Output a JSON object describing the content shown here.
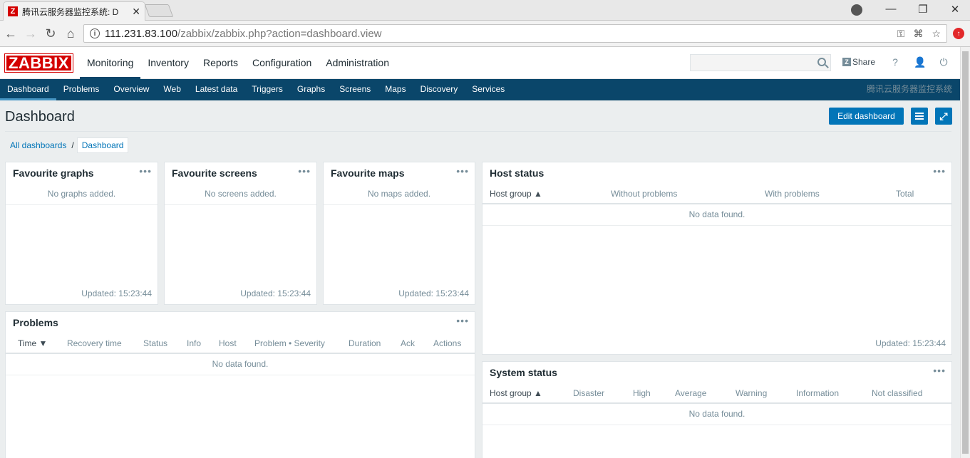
{
  "browser": {
    "tab_title": "腾讯云服务器监控系统: D",
    "tab_close": "✕",
    "url_host": "111.231.83.100",
    "url_path": "/zabbix/zabbix.php?action=dashboard.view",
    "minimize": "—",
    "restore": "❐",
    "close": "✕"
  },
  "header": {
    "logo": "ZABBIX",
    "menu": [
      "Monitoring",
      "Inventory",
      "Reports",
      "Configuration",
      "Administration"
    ],
    "share": "Share",
    "help": "?",
    "user": "👤",
    "logout": "⏻"
  },
  "submenu": {
    "items": [
      "Dashboard",
      "Problems",
      "Overview",
      "Web",
      "Latest data",
      "Triggers",
      "Graphs",
      "Screens",
      "Maps",
      "Discovery",
      "Services"
    ],
    "server_name": "腾讯云服务器监控系统"
  },
  "page": {
    "title": "Dashboard",
    "edit_button": "Edit dashboard",
    "breadcrumbs": {
      "all": "All dashboards",
      "sep": "/",
      "current": "Dashboard"
    }
  },
  "widgets": {
    "fav_graphs": {
      "title": "Favourite graphs",
      "empty": "No graphs added.",
      "updated": "Updated: 15:23:44"
    },
    "fav_screens": {
      "title": "Favourite screens",
      "empty": "No screens added.",
      "updated": "Updated: 15:23:44"
    },
    "fav_maps": {
      "title": "Favourite maps",
      "empty": "No maps added.",
      "updated": "Updated: 15:23:44"
    },
    "host_status": {
      "title": "Host status",
      "columns": [
        "Host group ▲",
        "Without problems",
        "With problems",
        "Total"
      ],
      "empty": "No data found.",
      "updated": "Updated: 15:23:44"
    },
    "problems": {
      "title": "Problems",
      "columns": [
        "Time ▼",
        "Recovery time",
        "Status",
        "Info",
        "Host",
        "Problem • Severity",
        "Duration",
        "Ack",
        "Actions"
      ],
      "empty": "No data found."
    },
    "system_status": {
      "title": "System status",
      "columns": [
        "Host group ▲",
        "Disaster",
        "High",
        "Average",
        "Warning",
        "Information",
        "Not classified"
      ],
      "empty": "No data found."
    },
    "dots": "•••"
  }
}
